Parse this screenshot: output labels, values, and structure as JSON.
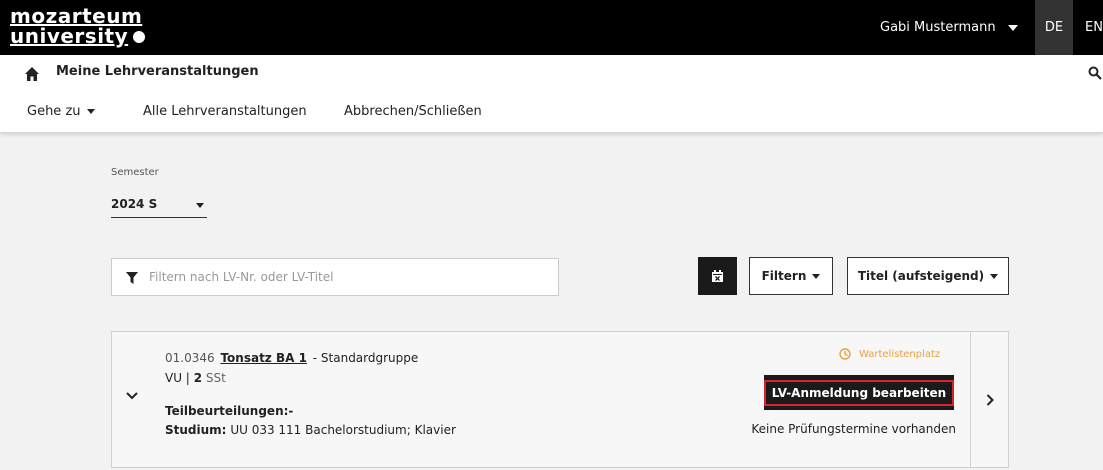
{
  "header": {
    "logo_line1": "mozarteum",
    "logo_line2": "university",
    "user_name": "Gabi Mustermann",
    "lang_de": "DE",
    "lang_en": "EN"
  },
  "subheader": {
    "title": "Meine Lehrveranstaltungen",
    "nav": {
      "goto": "Gehe zu",
      "all_courses": "Alle Lehrveranstaltungen",
      "cancel_close": "Abbrechen/Schließen"
    }
  },
  "semester": {
    "label": "Semester",
    "value": "2024 S"
  },
  "filter": {
    "placeholder": "Filtern nach LV-Nr. oder LV-Titel",
    "filter_button": "Filtern",
    "sort_button": "Titel (aufsteigend)"
  },
  "course": {
    "number": "01.0346",
    "title": "Tonsatz BA 1",
    "group": "- Standardgruppe",
    "type": "VU |",
    "hours": "2",
    "hours_unit": "SSt",
    "partial_assessments": "Teilbeurteilungen:-",
    "study_label": "Studium:",
    "study_value": "UU 033 111 Bachelorstudium; Klavier",
    "status": "Wartelistenplatz",
    "edit_button": "LV-Anmeldung bearbeiten",
    "exam_info": "Keine Prüfungstermine vorhanden"
  },
  "colors": {
    "topbar": "#000000",
    "status_orange": "#e8a23c",
    "highlight_red": "#d9232a",
    "dark_button": "#1a1a1a"
  },
  "icons": [
    "home-icon",
    "search-icon",
    "filter-icon",
    "calendar-icon",
    "clock-icon",
    "chevron-down-icon",
    "chevron-right-icon"
  ]
}
